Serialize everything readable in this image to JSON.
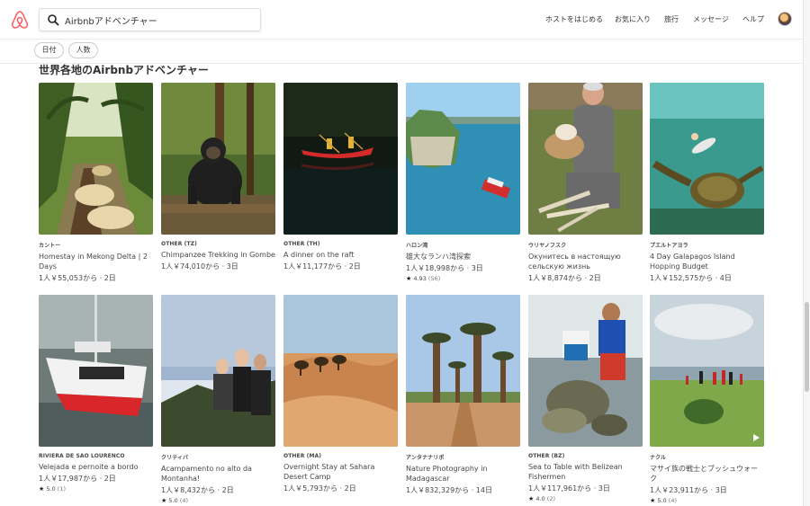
{
  "header": {
    "search": {
      "value": "Airbnbアドベンチャー"
    },
    "nav": [
      "ホストをはじめる",
      "お気に入り",
      "旅行",
      "メッセージ",
      "ヘルプ"
    ]
  },
  "filters": [
    "日付",
    "人数"
  ],
  "section": {
    "title": "世界各地のAirbnbアドベンチャー"
  },
  "cards": [
    {
      "location": "カントー",
      "title": "Homestay in Mekong Delta | 2 Days",
      "price": "1人￥55,053から · 2日"
    },
    {
      "location": "OTHER (TZ)",
      "title": "Chimpanzee Trekking in Gombe",
      "price": "1人￥74,010から · 3日"
    },
    {
      "location": "OTHER (TH)",
      "title": "A dinner on the raft",
      "price": "1人￥11,177から · 2日"
    },
    {
      "location": "ハロン湾",
      "title": "雄大なランハ湾探索",
      "price": "1人￥18,998から · 3日",
      "rating": "4.93",
      "reviews": "(56)"
    },
    {
      "location": "ウリヤノフスク",
      "title": "Окунитесь в настоящую сельскую жизнь",
      "price": "1人￥8,874から · 2日"
    },
    {
      "location": "プエルトアヨラ",
      "title": "4 Day Galapagos Island Hopping Budget",
      "price": "1人￥152,575から · 4日"
    },
    {
      "location": "RIVIERA DE SAO LOURENCO",
      "title": "Velejada e pernoite a bordo",
      "price": "1人￥17,987から · 2日",
      "rating": "5.0",
      "reviews": "(1)"
    },
    {
      "location": "クリティバ",
      "title": "Acampamento no alto da Montanha!",
      "price": "1人￥8,432から · 2日",
      "rating": "5.0",
      "reviews": "(4)"
    },
    {
      "location": "OTHER (MA)",
      "title": "Overnight Stay at Sahara Desert Camp",
      "price": "1人￥5,793から · 2日"
    },
    {
      "location": "アンタナナリボ",
      "title": "Nature Photography in Madagascar",
      "price": "1人￥832,329から · 14日"
    },
    {
      "location": "OTHER (BZ)",
      "title": "Sea to Table with Belizean Fishermen",
      "price": "1人￥117,961から · 3日",
      "rating": "4.0",
      "reviews": "(2)"
    },
    {
      "location": "ナクル",
      "title": "マサイ族の戦士とブッシュウォーク",
      "price": "1人￥23,911から · 3日",
      "rating": "5.0",
      "reviews": "(4)"
    }
  ],
  "icons": {
    "logo": "airbnb-logo",
    "search": "search-icon",
    "play": "play-icon",
    "star": "★"
  },
  "colors": {
    "brand": "#FF5A5F"
  }
}
